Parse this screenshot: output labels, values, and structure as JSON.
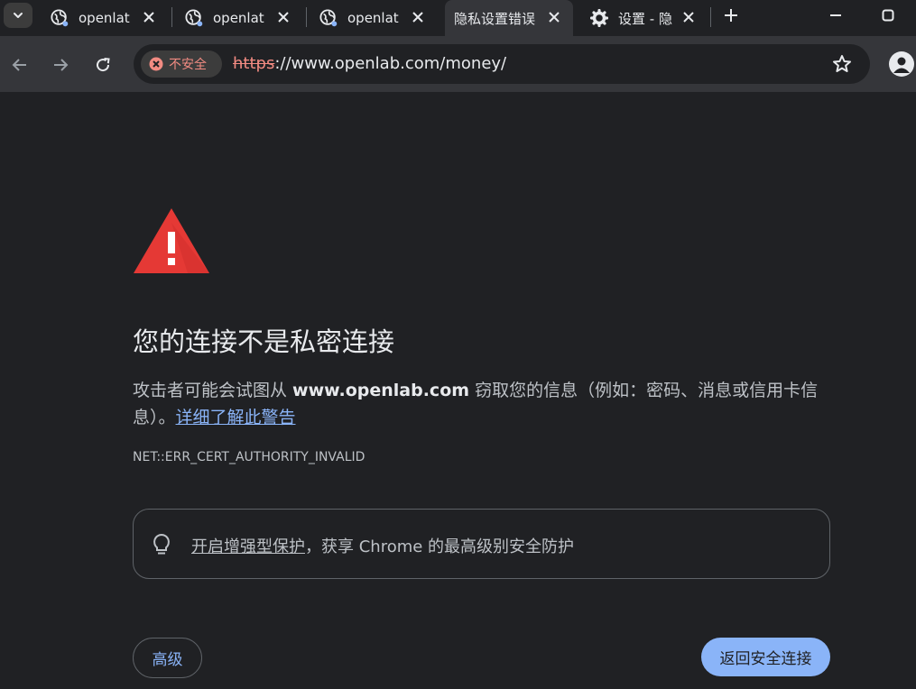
{
  "tabs": [
    {
      "title": "openlat",
      "favicon": "globe-icon",
      "active": false
    },
    {
      "title": "openlat",
      "favicon": "globe-icon",
      "active": false
    },
    {
      "title": "openlat",
      "favicon": "globe-icon",
      "active": false
    },
    {
      "title": "隐私设置错误",
      "favicon": "",
      "active": true
    },
    {
      "title": "设置 - 隐",
      "favicon": "gear-icon",
      "active": false
    }
  ],
  "toolbar": {
    "security_label": "不安全",
    "url_scheme": "https",
    "url_rest": "://www.openlab.com/money/"
  },
  "interstitial": {
    "heading": "您的连接不是私密连接",
    "desc_prefix": "攻击者可能会试图从 ",
    "desc_domain": "www.openlab.com",
    "desc_suffix": " 窃取您的信息（例如：密码、消息或信用卡信息）。",
    "learn_more": "详细了解此警告",
    "error_code": "NET::ERR_CERT_AUTHORITY_INVALID",
    "promo_link": "开启增强型保护",
    "promo_text": "，获享 Chrome 的最高级别安全防护",
    "advanced_button": "高级",
    "back_button": "返回安全连接"
  },
  "colors": {
    "background": "#202124",
    "warning_red": "#e53935",
    "link_blue": "#8ab4f8",
    "insecure_red": "#f28b82"
  }
}
